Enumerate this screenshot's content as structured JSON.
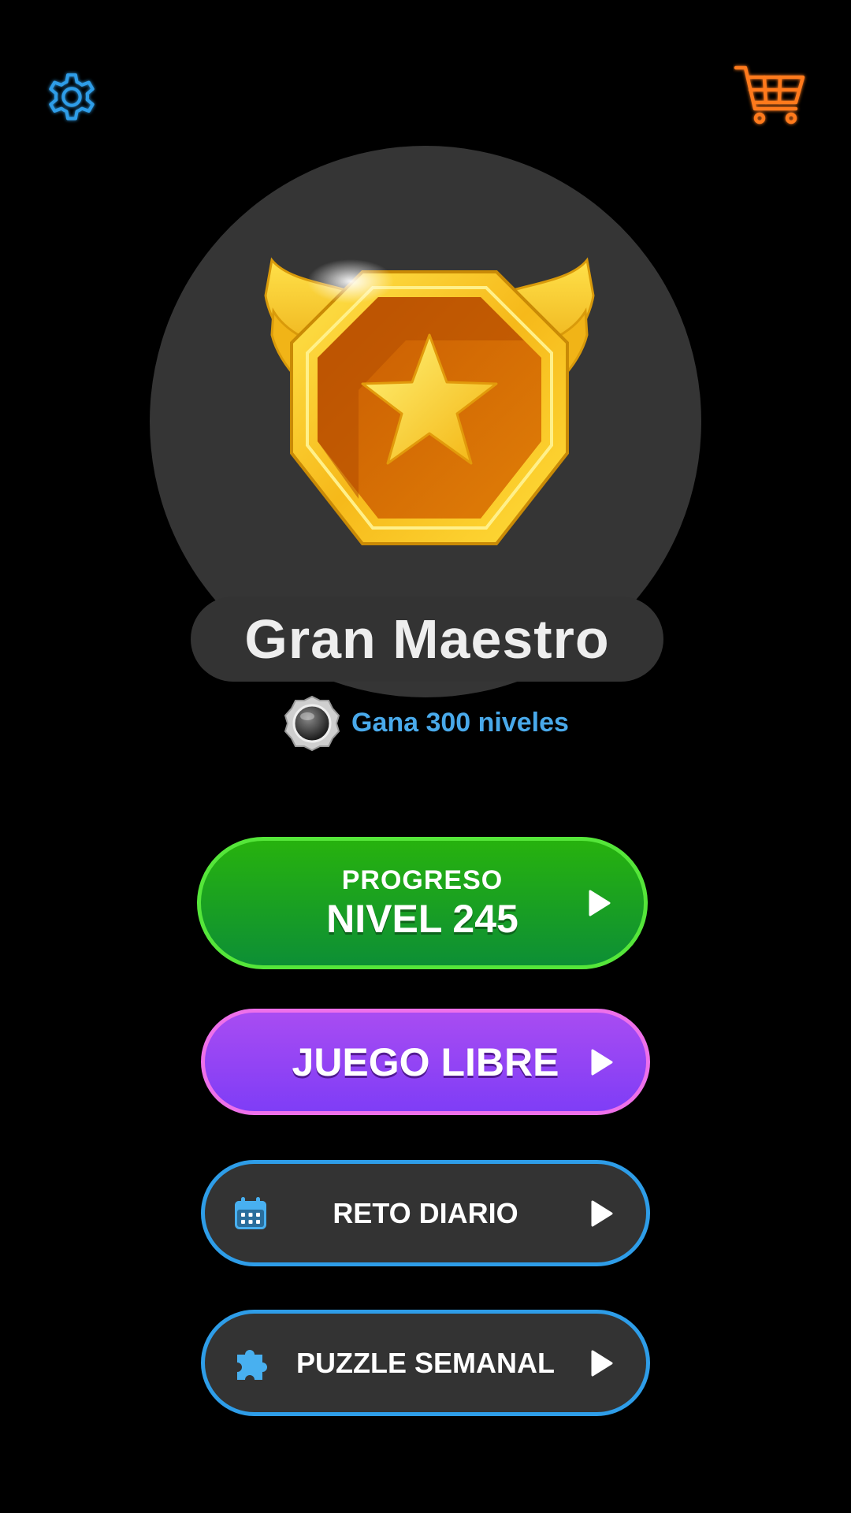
{
  "header": {
    "settings_icon": "gear-icon",
    "cart_icon": "shopping-cart-icon"
  },
  "hero": {
    "badge_icon": "winged-star-medal",
    "title": "Gran Maestro",
    "requirement_icon": "silver-coin-icon",
    "requirement": "Gana 300 niveles"
  },
  "buttons": {
    "progress": {
      "caption": "PROGRESO",
      "label": "NIVEL 245",
      "icon": "play-icon"
    },
    "free_play": {
      "label": "JUEGO LIBRE",
      "icon": "play-icon"
    },
    "daily": {
      "label": "RETO DIARIO",
      "icon": "calendar-icon"
    },
    "weekly": {
      "label": "PUZZLE SEMANAL",
      "icon": "puzzle-piece-icon"
    }
  },
  "colors": {
    "background": "#000000",
    "settings_accent": "#2e9de8",
    "cart_accent": "#ff7a1f",
    "requirement_text": "#49a9ea",
    "progress_border": "#55e63a",
    "progress_fill": "#1ba022",
    "free_border": "#ee70ea",
    "free_fill": "#9344f4",
    "dark_border": "#2e9de8",
    "dark_fill": "#333333"
  }
}
